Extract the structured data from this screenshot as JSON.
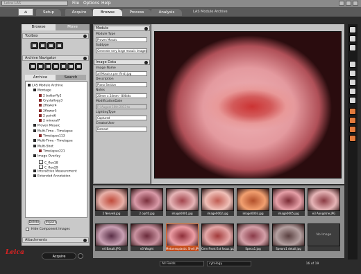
{
  "app": {
    "title": "Leica LAS",
    "window_caption": "LAS Module Archive"
  },
  "menu": {
    "items": [
      "File",
      "Options",
      "Help"
    ]
  },
  "workflow": {
    "home_label": "⌂",
    "tabs": [
      "Setup",
      "Acquire",
      "Browse",
      "Process",
      "Analysis"
    ],
    "active_tab": "Browse"
  },
  "left_panel": {
    "tabs": [
      "Browse",
      "Move"
    ],
    "toolbox_title": "Toolbox",
    "archive_navigator_title": "Archive Navigator",
    "archive_tabs": [
      "Archive",
      "Search"
    ],
    "tree": [
      {
        "label": "LAS Module Archive",
        "level": 0,
        "kind": "folder"
      },
      {
        "label": "Montage",
        "level": 1,
        "kind": "folder"
      },
      {
        "label": "2 butterfly2",
        "level": 2,
        "kind": "item"
      },
      {
        "label": "Crystallogy3",
        "level": 2,
        "kind": "item"
      },
      {
        "label": "2flower4",
        "level": 2,
        "kind": "item"
      },
      {
        "label": "2flower5",
        "level": 2,
        "kind": "item"
      },
      {
        "label": "2 paint6",
        "level": 2,
        "kind": "item"
      },
      {
        "label": "2 mineral7",
        "level": 2,
        "kind": "item"
      },
      {
        "label": "Proven Mosaic",
        "level": 1,
        "kind": "folder"
      },
      {
        "label": "Multi-Time - Timelapse",
        "level": 1,
        "kind": "folder"
      },
      {
        "label": "Timelapse113",
        "level": 2,
        "kind": "item"
      },
      {
        "label": "Multi-Time - Timelapse",
        "level": 1,
        "kind": "folder"
      },
      {
        "label": "Multi-Shot",
        "level": 1,
        "kind": "folder"
      },
      {
        "label": "Timelapse221",
        "level": 2,
        "kind": "item"
      },
      {
        "label": "Image Overlay",
        "level": 1,
        "kind": "folder"
      },
      {
        "label": "C_fluo18",
        "level": 2,
        "kind": "doc"
      },
      {
        "label": "C_fluo29",
        "level": 2,
        "kind": "doc"
      },
      {
        "label": "Interactive Measurement",
        "level": 1,
        "kind": "folder"
      },
      {
        "label": "Extended Annotation",
        "level": 1,
        "kind": "folder"
      }
    ],
    "buttons": [
      "Delete",
      "Import"
    ],
    "hide_components_label": "Hide Component Images",
    "attachments_title": "Attachments"
  },
  "form": {
    "module_title": "Module",
    "module_type_label": "Module Type",
    "module_type_value": "Proven Mosaic",
    "subtype_label": "Subtype",
    "subtype_value": "Generate very large mosaic images",
    "image_data_title": "Image Data",
    "image_name_label": "Image Name",
    "image_name_value": "all Mosaics pro (first).jpg",
    "description_label": "Description",
    "description_value": "Plano Section",
    "notes_label": "Notes",
    "notes_value": "20mm x 24mm - 800dts",
    "modification_label": "ModificationDate",
    "modification_value": "Fri August 16th 2013 to",
    "lighting_label": "LightingType",
    "lighting_value": "Captured",
    "creator_label": "CreatorUser",
    "creator_value": "Damoot"
  },
  "thumbnails": [
    {
      "caption": "2 Nerve8.jpg",
      "c1": "#e8b0a8",
      "c2": "#c04a3a"
    },
    {
      "caption": "2 oprt0.jpg",
      "c1": "#d99aa8",
      "c2": "#7a2f3c"
    },
    {
      "caption": "image0001.jpg",
      "c1": "#e6b4b6",
      "c2": "#a2444c"
    },
    {
      "caption": "image0002.jpg",
      "c1": "#f0c0b8",
      "c2": "#c05c52"
    },
    {
      "caption": "image0003.jpg",
      "c1": "#f2a070",
      "c2": "#b24f2a"
    },
    {
      "caption": "image0005.jpg",
      "c1": "#e6a0a8",
      "c2": "#7a2a34"
    },
    {
      "caption": "e3 Aongetne.JPG",
      "c1": "#e6b4b6",
      "c2": "#8a3a42"
    },
    {
      "caption": "e4 Basalt.JPG",
      "c1": "#c9a0b4",
      "c2": "#5a2e46"
    },
    {
      "caption": "e3 Woght",
      "c1": "#c992a0",
      "c2": "#6a2a3a"
    },
    {
      "caption": "Metaneoplastic Shell.JPG",
      "c1": "#ec9da4",
      "c2": "#8e2e38",
      "selected": true
    },
    {
      "caption": "Cerv Front Ext focus.jpg",
      "c1": "#e5a8a8",
      "c2": "#a23a3a"
    },
    {
      "caption": "Specu1.jpg",
      "c1": "#d4a0a8",
      "c2": "#8a3a48"
    },
    {
      "caption": "Speoro1 detail.jpg",
      "c1": "#b4a0a0",
      "c2": "#5a4040"
    },
    {
      "caption": "",
      "c1": "#3e3e3e",
      "c2": "#2a2a2a",
      "label": "No Image"
    }
  ],
  "footer": {
    "brand": "Leica",
    "acquire_label": "Acquire",
    "filter_value": "All Fields",
    "search_value": "cytology",
    "page_count": "16 of 19"
  }
}
